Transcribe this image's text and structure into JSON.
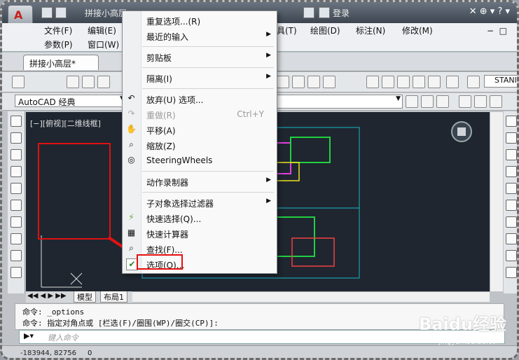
{
  "window": {
    "title": "拼接小高层"
  },
  "user": {
    "login_label": "登录"
  },
  "menubar": {
    "row1": [
      "文件(F)",
      "编辑(E)",
      "具(T)",
      "绘图(D)",
      "标注(N)",
      "修改(M)"
    ],
    "row2": [
      "参数(P)",
      "窗口(W)"
    ]
  },
  "document_tab": {
    "label": "拼接小高层*"
  },
  "toolbar": {
    "style_label": "STANI"
  },
  "workspace": {
    "selected": "AutoCAD 经典"
  },
  "viewport": {
    "label": "[−][俯视][二维线框]"
  },
  "context_menu": {
    "items": [
      {
        "label": "重复选项...(R)",
        "icon": "",
        "submenu": false
      },
      {
        "label": "最近的输入",
        "icon": "",
        "submenu": true
      },
      {
        "label": "剪贴板",
        "icon": "",
        "submenu": true
      },
      {
        "label": "隔离(I)",
        "icon": "",
        "submenu": true
      },
      {
        "label": "放弃(U) 选项...",
        "icon": "undo-icon",
        "submenu": false
      },
      {
        "label": "重做(R)",
        "icon": "redo-icon",
        "shortcut": "Ctrl+Y",
        "disabled": true,
        "submenu": false
      },
      {
        "label": "平移(A)",
        "icon": "pan-icon",
        "submenu": false
      },
      {
        "label": "缩放(Z)",
        "icon": "zoom-icon",
        "submenu": false
      },
      {
        "label": "SteeringWheels",
        "icon": "steeringwheel-icon",
        "submenu": false
      },
      {
        "label": "动作录制器",
        "icon": "",
        "submenu": true
      },
      {
        "label": "子对象选择过滤器",
        "icon": "",
        "submenu": true
      },
      {
        "label": "快速选择(Q)...",
        "icon": "quick-select-icon",
        "submenu": false
      },
      {
        "label": "快速计算器",
        "icon": "calculator-icon",
        "submenu": false
      },
      {
        "label": "查找(F)...",
        "icon": "find-icon",
        "submenu": false
      },
      {
        "label": "选项(O)...",
        "icon": "options-check-icon",
        "submenu": false
      }
    ]
  },
  "layout_tabs": [
    "模型",
    "布局1"
  ],
  "command": {
    "line1": "命令: _options",
    "line2": "命令: 指定对角点或 [栏选(F)/圈围(WP)/圈交(CP)]:",
    "placeholder": "键入命令"
  },
  "status": {
    "coords": "-183944, 82756",
    "zero": "0"
  },
  "watermark": {
    "text": "Baidu经验",
    "url": "jingyan.baidu.com"
  },
  "colors": {
    "highlight_red": "#e81010",
    "canvas_bg": "#1f2630"
  }
}
